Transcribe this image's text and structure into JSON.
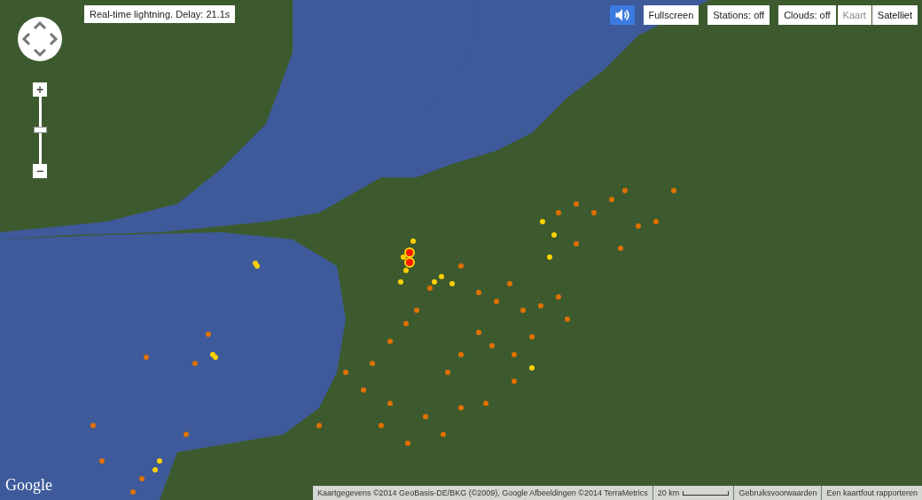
{
  "status_text": "Real-time lightning. Delay: 21.1s",
  "sound": {
    "on": true
  },
  "buttons": [
    {
      "label": "Fullscreen"
    },
    {
      "label": "Stations: off"
    },
    {
      "label": "Clouds: off"
    }
  ],
  "map_types": [
    {
      "label": "Kaart",
      "selected": false
    },
    {
      "label": "Satelliet",
      "selected": true
    }
  ],
  "zoom": {
    "in": "+",
    "out": "−",
    "level": 0.5
  },
  "logo": "Google",
  "footer": {
    "attribution": "Kaartgegevens ©2014 GeoBasis-DE/BKG (©2009), Google Afbeeldingen ©2014 TerraMetrics",
    "scale": "20 km",
    "terms": "Gebruiksvoorwaarden",
    "report": "Een kaartfout rapporteren"
  }
}
